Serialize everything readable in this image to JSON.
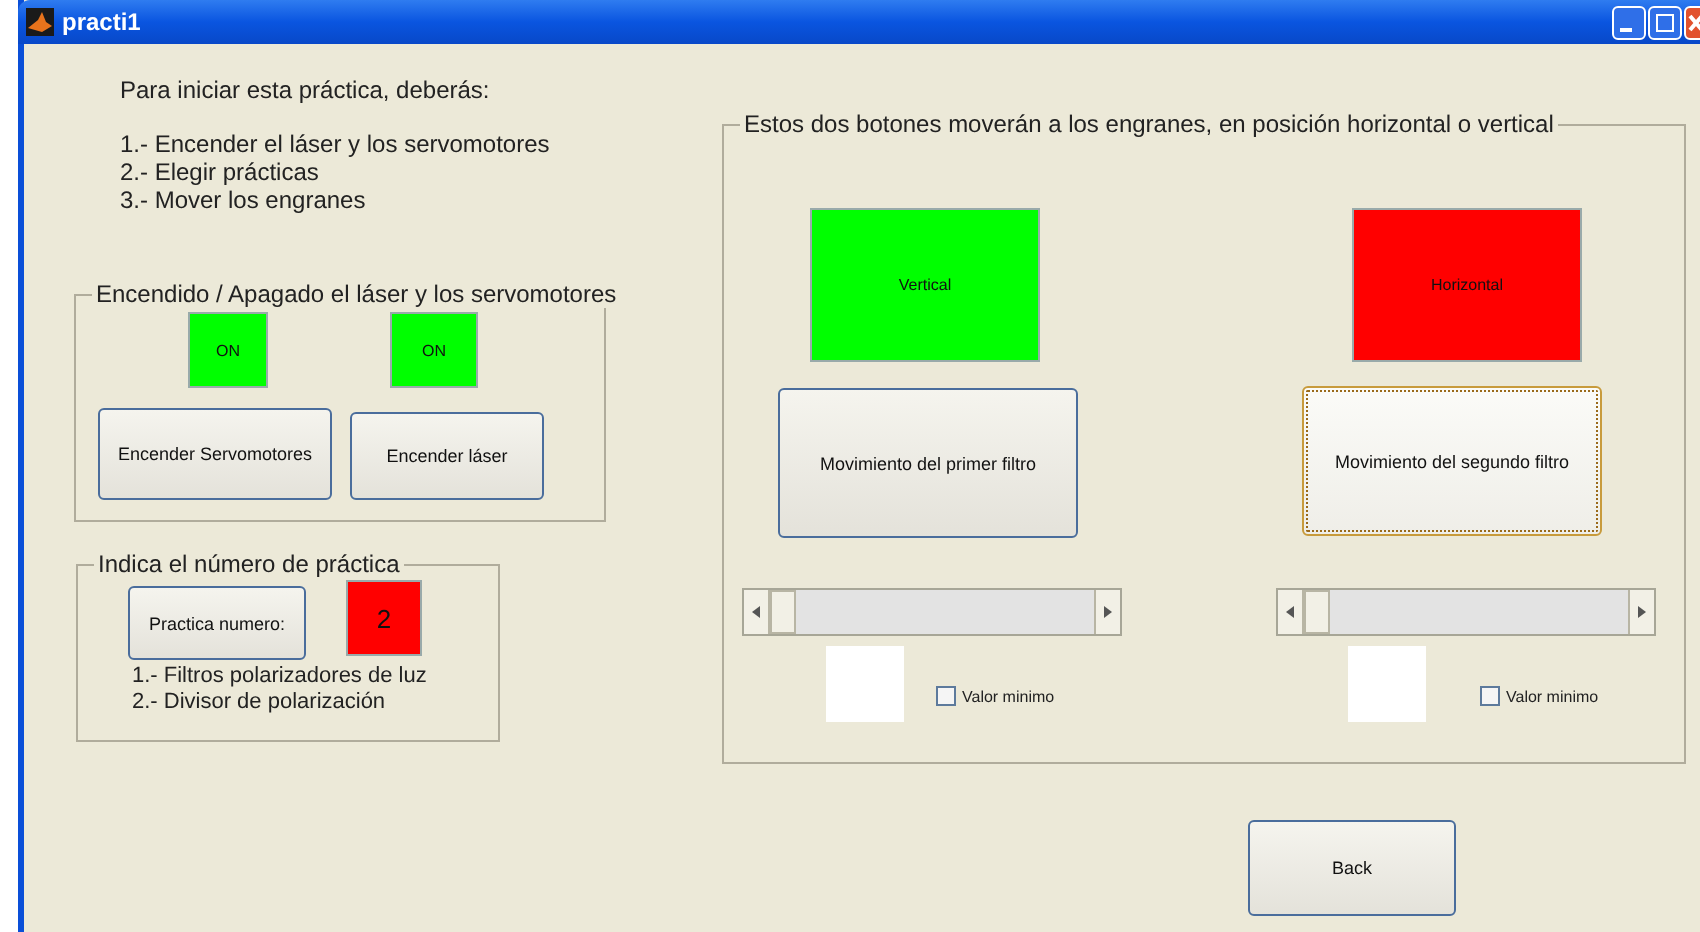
{
  "window": {
    "title": "practi1"
  },
  "instructions": {
    "heading": "Para iniciar esta práctica, deberás:",
    "steps": [
      "1.- Encender el láser y los servomotores",
      "2.- Elegir prácticas",
      "3.- Mover los engranes"
    ]
  },
  "power_panel": {
    "title": "Encendido / Apagado el láser y los servomotores",
    "indicators": [
      {
        "text": "ON",
        "color": "#00ff00"
      },
      {
        "text": "ON",
        "color": "#00ff00"
      }
    ],
    "buttons": [
      {
        "label": "Encender Servomotores",
        "focused": false
      },
      {
        "label": "Encender láser",
        "focused": false
      }
    ]
  },
  "practice_panel": {
    "title": "Indica el número de práctica",
    "button": {
      "label": "Practica numero:",
      "focused": false
    },
    "value": {
      "text": "2",
      "color": "#ff0000"
    },
    "options": [
      "1.- Filtros polarizadores de luz",
      "2.- Divisor de polarización"
    ]
  },
  "gears_panel": {
    "title": "Estos dos botones moverán a los engranes, en posición horizontal o vertical",
    "columns": [
      {
        "indicator": {
          "text": "Vertical",
          "color": "#00ff00"
        },
        "button": {
          "label": "Movimiento del primer filtro",
          "focused": false
        },
        "checkbox": {
          "label": "Valor minimo",
          "checked": false
        }
      },
      {
        "indicator": {
          "text": "Horizontal",
          "color": "#ff0000"
        },
        "button": {
          "label": "Movimiento del segundo filtro",
          "focused": true
        },
        "checkbox": {
          "label": "Valor minimo",
          "checked": false
        }
      }
    ]
  },
  "back_button": {
    "label": "Back",
    "focused": false
  }
}
